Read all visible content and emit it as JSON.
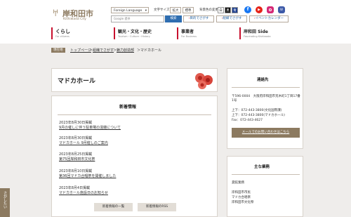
{
  "header": {
    "logo_title": "岸和田市",
    "logo_sub": "Kishiwada City",
    "lang_label": "Foreign Language",
    "lang_arrow": "▾",
    "fontsize_label": "文字サイズ",
    "enlarge": "拡大",
    "standard": "標準",
    "bgcolor_label": "背景色の変更",
    "bg_options": [
      "白",
      "黒",
      "青"
    ],
    "search_placeholder": "Google 提供",
    "search_button": "検索",
    "quick_links": [
      "目的でさがす",
      "組織でさがす",
      "イベントカレンダー"
    ],
    "social_icons": [
      "facebook-icon",
      "youtube-icon",
      "instagram-icon",
      "line-icon"
    ],
    "accent_color": "#c8102e"
  },
  "nav": [
    {
      "label": "くらし",
      "sub": "For citizens"
    },
    {
      "label": "観光・文化・歴史",
      "sub": "Tourism・Culture・History"
    },
    {
      "label": "事業者",
      "sub": "For Business"
    },
    {
      "label": "岸和田 Side",
      "sub": "Fascinating Kishiwada"
    }
  ],
  "breadcrumb": {
    "badge": "現在地",
    "items": [
      "トップページ",
      "組織でさがす",
      "魅力創造部",
      "マドカホール"
    ],
    "sep": "＞"
  },
  "page_title": "マドカホール",
  "news": {
    "heading": "新着情報",
    "items": [
      {
        "date": "2023年8月30日掲載",
        "title": "9月の催しに伴う駐車場の混雑について"
      },
      {
        "date": "2023年8月30日掲載",
        "title": "マドカホール 9月催しのご案内"
      },
      {
        "date": "2023年8月25日掲載",
        "title": "第75回岸和田市文化祭"
      },
      {
        "date": "2023年8月10日掲載",
        "title": "第36回マドカ合唱祭を開催しました"
      },
      {
        "date": "2023年8月4日掲載",
        "title": "マドカホール施設日のお知らせ"
      }
    ],
    "list_button": "新着情報の一覧",
    "rss_button": "新着情報のRSS"
  },
  "contact": {
    "heading": "連絡先",
    "lines": [
      "〒596-0004　大阪府岸和田市荒木町1丁目17番1号",
      "1丁目17番1号",
      "上下：072-443-3800(文化国際課)",
      "上下：072-443-3800(マドカホール)",
      "Fax：072-443-4627"
    ],
    "mail_link": "メールでのお問い合わせはこちら"
  },
  "duties": {
    "heading": "主な業務",
    "lines": [
      "貸館業務",
      "",
      "岸和田市市民",
      "マドカ合唱祭",
      "岸和田市文化祭"
    ]
  },
  "side_tab": "さがしたい"
}
